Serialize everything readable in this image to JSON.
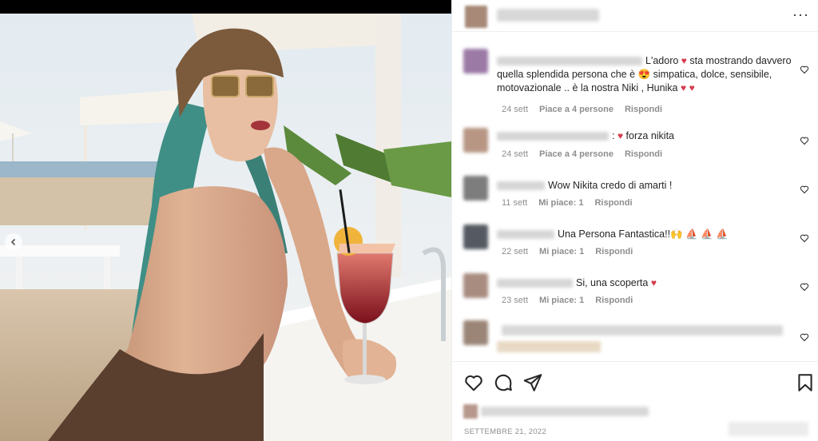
{
  "post": {
    "header": {
      "more_label": "···"
    },
    "photo": {
      "alt": "",
      "colors": {
        "sky": "#e8eef3",
        "bar_top": "#f4f2ef",
        "drink": "#a0252b",
        "hair": "#3f8f86",
        "cap": "#7c5a3c"
      }
    }
  },
  "comments": [
    {
      "text_before": "L'adoro ",
      "text_after": " sta mostrando davvero quella splendida persona che è ",
      "text_tail": " simpatica, dolce, sensibile, motovazionale .. è la nostra Niki , Hunika ",
      "age": "24 sett",
      "likes": "Piace a 4 persone",
      "reply": "Rispondi",
      "avatar_color": "#9b7aa6"
    },
    {
      "text_before": ": ",
      "text_after": " forza nikita",
      "age": "24 sett",
      "likes": "Piace a 4 persone",
      "reply": "Rispondi",
      "avatar_color": "#b79684"
    },
    {
      "text": "Wow Nikita credo di amarti !",
      "age": "11 sett",
      "likes": "Mi piace: 1",
      "reply": "Rispondi",
      "avatar_color": "#7d7d7d"
    },
    {
      "text": "Una Persona Fantastica!!🙌 ⛵ ⛵ ⛵",
      "age": "22 sett",
      "likes": "Mi piace: 1",
      "reply": "Rispondi",
      "avatar_color": "#555a62"
    },
    {
      "text": "Si, una scoperta ",
      "age": "23 sett",
      "likes": "Mi piace: 1",
      "reply": "Rispondi",
      "avatar_color": "#a88c80"
    }
  ],
  "footer": {
    "date": "SETTEMBRE 21, 2022"
  },
  "icons": {
    "heart": "heart-icon",
    "comment": "comment-icon",
    "share": "share-icon",
    "save": "bookmark-icon"
  },
  "colors": {
    "heart_red": "#d43a4c",
    "meta_gray": "#8e8e8e",
    "text": "#262626"
  }
}
